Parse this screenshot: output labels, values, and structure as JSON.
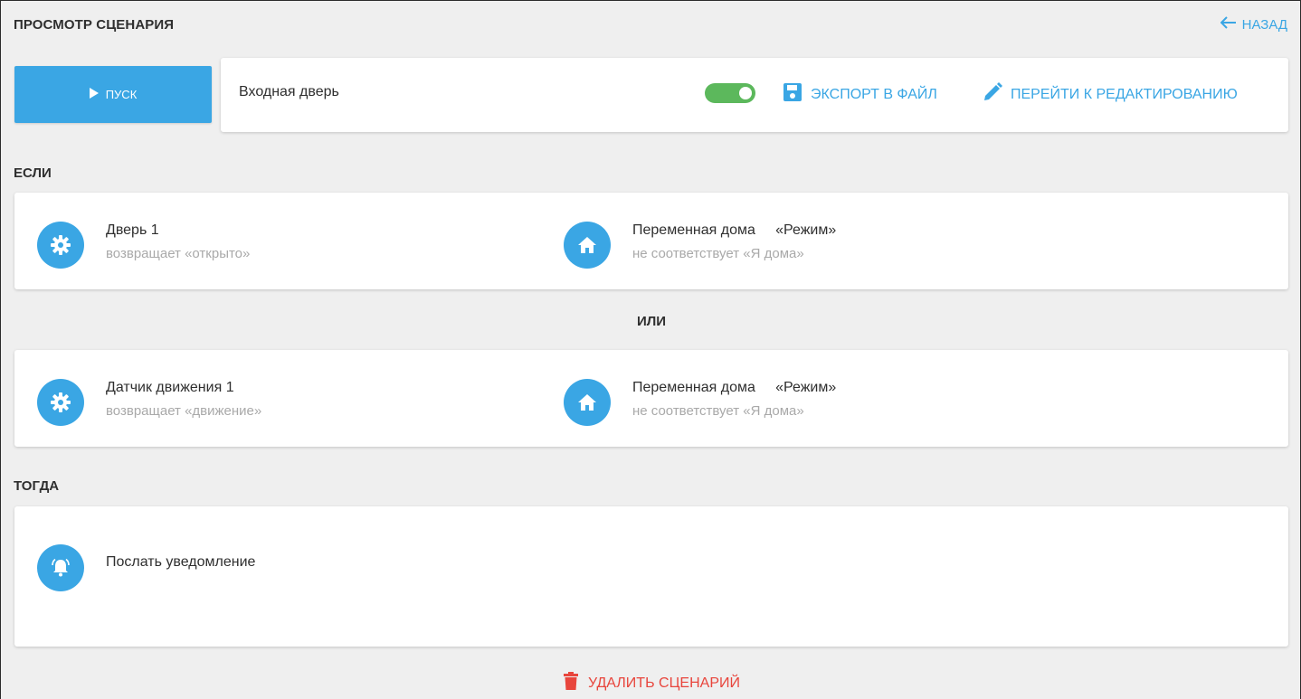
{
  "header": {
    "title": "ПРОСМОТР СЦЕНАРИЯ",
    "back_label": "НАЗАД"
  },
  "toolbar": {
    "run_label": "ПУСК",
    "scenario_name": "Входная дверь",
    "enabled": true,
    "export_label": "ЭКСПОРТ В ФАЙЛ",
    "edit_label": "ПЕРЕЙТИ К РЕДАКТИРОВАНИЮ"
  },
  "sections": {
    "if_label": "ЕСЛИ",
    "or_label": "ИЛИ",
    "then_label": "ТОГДА"
  },
  "condition_groups": [
    {
      "left": {
        "icon": "gear-icon",
        "title": "Дверь 1",
        "subtitle": "возвращает «открыто»"
      },
      "right": {
        "icon": "home-icon",
        "title": "Переменная дома     «Режим»",
        "subtitle": "не соответствует «Я дома»"
      }
    },
    {
      "left": {
        "icon": "gear-icon",
        "title": "Датчик движения 1",
        "subtitle": "возвращает «движение»"
      },
      "right": {
        "icon": "home-icon",
        "title": "Переменная дома     «Режим»",
        "subtitle": "не соответствует «Я дома»"
      }
    }
  ],
  "actions": [
    {
      "icon": "bell-icon",
      "title": "Послать уведомление"
    }
  ],
  "footer": {
    "delete_label": "УДАЛИТЬ СЦЕНАРИЙ"
  },
  "colors": {
    "accent": "#3aa6e4",
    "toggle_on": "#5cb85c",
    "danger": "#e8453c",
    "background": "#efefef"
  }
}
